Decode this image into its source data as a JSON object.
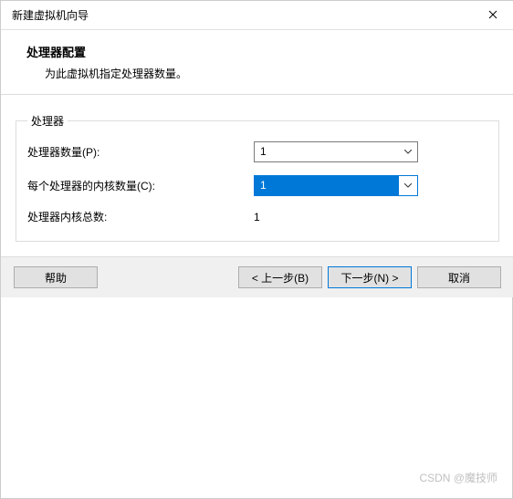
{
  "window": {
    "title": "新建虚拟机向导"
  },
  "header": {
    "title": "处理器配置",
    "description": "为此虚拟机指定处理器数量。"
  },
  "group": {
    "legend": "处理器",
    "rows": {
      "processors": {
        "label": "处理器数量(P):",
        "value": "1"
      },
      "cores": {
        "label": "每个处理器的内核数量(C):",
        "value": "1"
      },
      "total": {
        "label": "处理器内核总数:",
        "value": "1"
      }
    }
  },
  "footer": {
    "help": "帮助",
    "back": "< 上一步(B)",
    "next": "下一步(N) >",
    "cancel": "取消"
  },
  "watermark": "CSDN @魔技师"
}
